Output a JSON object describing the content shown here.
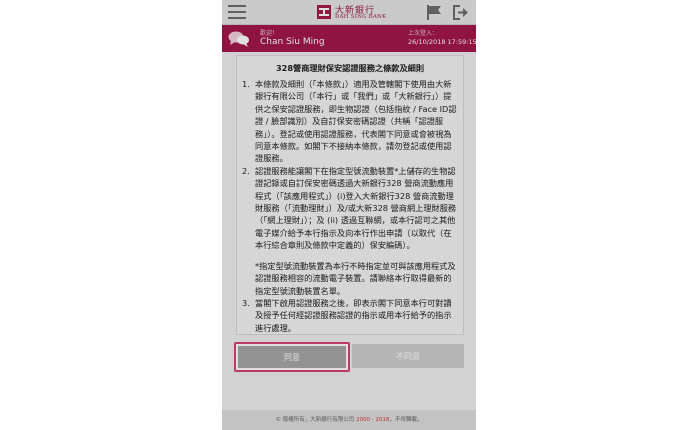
{
  "header": {
    "logo_cn": "大新銀行",
    "logo_en": "DAH SING BANK"
  },
  "userbar": {
    "welcome": "歡迎！",
    "username": "Chan Siu Ming",
    "last_login_label": "上次登入：",
    "last_login_value": "26/10/2018 17:59:15"
  },
  "terms": {
    "title": "328營商理財保安認證服務之條款及細則",
    "items": [
      {
        "num": "1.",
        "text": "本條款及細則（「本條款」）適用及管轄閣下使用由大新銀行有限公司（「本行」或「我們」或「大新銀行」）提供之保安認證服務，即生物認證（包括指紋 / Face ID認證 / 臉部識別）及自訂保安密碼認證（共稱「認證服務」）。登記或使用認證服務，代表閣下同意或會被視為同意本條款。如閣下不接納本條款，請勿登記或使用認證服務。"
      },
      {
        "num": "2.",
        "text": "認證服務能讓閣下在指定型號流動裝置*上儲存的生物認證記錄或自訂保安密碼透過大新銀行328 營商流動應用程式（「該應用程式」）(i)登入大新銀行328 營商流動理財服務（「流動理財」）及/或大新328 營商網上理財服務（「網上理財」）；及 (ii) 透過互聯網，或本行認可之其他電子媒介給予本行指示及向本行作出申請（以取代（在本行綜合章則及條款中定義的）保安編碼）。"
      }
    ],
    "note": "*指定型號流動裝置為本行不時指定並可與該應用程式及認證服務相容的流動電子裝置。請聯絡本行取得最新的指定型號流動裝置名單。",
    "item3_num": "3.",
    "item3_text": "當閣下啟用認證服務之後，即表示閣下同意本行可對讀及授予任何經認證服務認證的指示或用本行給予的指示進行處理。"
  },
  "buttons": {
    "agree": "同意",
    "disagree": "不同意"
  },
  "footer": {
    "prefix": "© 版權所有，大新銀行有限公司 ",
    "year_start": "2000",
    "dash": " - ",
    "year_end": "2018",
    "suffix": "，不得轉載。"
  },
  "colors": {
    "brand": "#a3174a",
    "highlight_border": "#d6456f"
  },
  "icons": [
    "menu-icon",
    "bank-logo-icon",
    "flag-icon",
    "logout-icon",
    "chat-bubbles-icon"
  ]
}
